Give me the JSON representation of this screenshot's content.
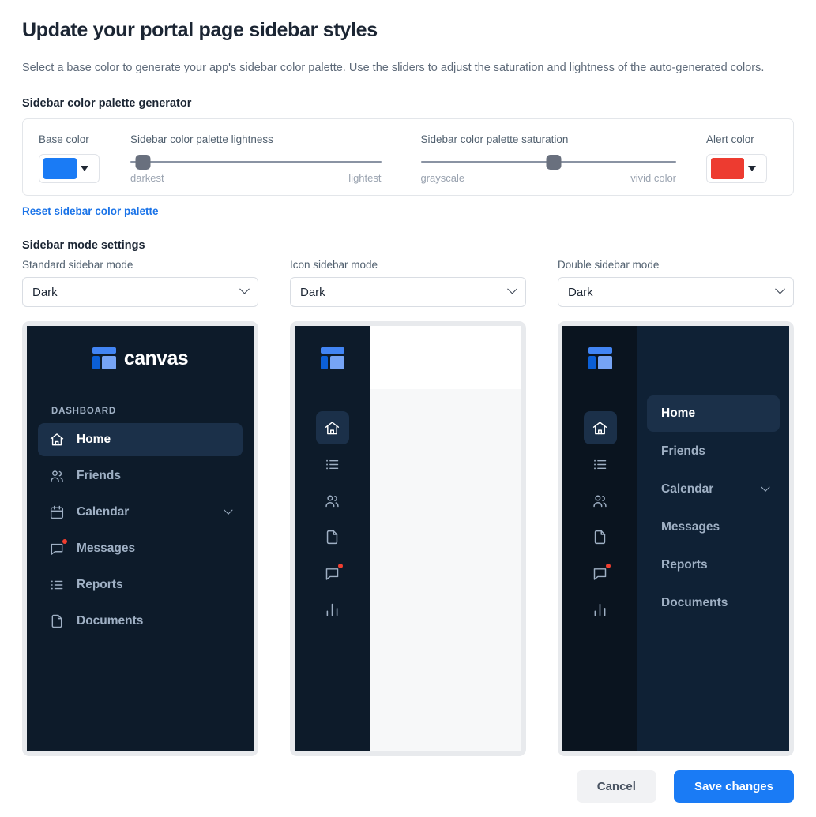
{
  "header": {
    "title": "Update your portal page sidebar styles",
    "description": "Select a base color to generate your app's sidebar color palette. Use the sliders to adjust the saturation and lightness of the auto-generated colors."
  },
  "palette": {
    "heading": "Sidebar color palette generator",
    "base_color_label": "Base color",
    "base_color_value": "#1a7bf5",
    "lightness": {
      "label": "Sidebar color palette lightness",
      "min_label": "darkest",
      "max_label": "lightest",
      "value_percent": 5
    },
    "saturation": {
      "label": "Sidebar color palette saturation",
      "min_label": "grayscale",
      "max_label": "vivid color",
      "value_percent": 52
    },
    "alert_color_label": "Alert color",
    "alert_color_value": "#ed3b30",
    "reset_link": "Reset sidebar color palette"
  },
  "modes": {
    "heading": "Sidebar mode settings",
    "items": [
      {
        "label": "Standard sidebar mode",
        "value": "Dark"
      },
      {
        "label": "Icon sidebar mode",
        "value": "Dark"
      },
      {
        "label": "Double sidebar mode",
        "value": "Dark"
      }
    ]
  },
  "preview": {
    "logo_word": "canvas",
    "section_title": "DASHBOARD",
    "standard_nav": [
      {
        "label": "Home",
        "icon": "home-icon",
        "active": true
      },
      {
        "label": "Friends",
        "icon": "users-icon",
        "active": false
      },
      {
        "label": "Calendar",
        "icon": "calendar-icon",
        "active": false,
        "chevron": true
      },
      {
        "label": "Messages",
        "icon": "message-icon",
        "active": false,
        "dot": true
      },
      {
        "label": "Reports",
        "icon": "list-icon",
        "active": false
      },
      {
        "label": "Documents",
        "icon": "document-icon",
        "active": false
      }
    ],
    "icon_rail": [
      {
        "icon": "home-icon",
        "active": true
      },
      {
        "icon": "list-icon",
        "active": false
      },
      {
        "icon": "users-icon",
        "active": false
      },
      {
        "icon": "document-icon",
        "active": false
      },
      {
        "icon": "message-icon",
        "active": false,
        "dot": true
      },
      {
        "icon": "chart-icon",
        "active": false
      }
    ],
    "double_nav": [
      {
        "label": "Home",
        "active": true
      },
      {
        "label": "Friends",
        "active": false
      },
      {
        "label": "Calendar",
        "active": false,
        "chevron": true
      },
      {
        "label": "Messages",
        "active": false
      },
      {
        "label": "Reports",
        "active": false
      },
      {
        "label": "Documents",
        "active": false
      }
    ]
  },
  "footer": {
    "cancel_label": "Cancel",
    "save_label": "Save changes"
  }
}
